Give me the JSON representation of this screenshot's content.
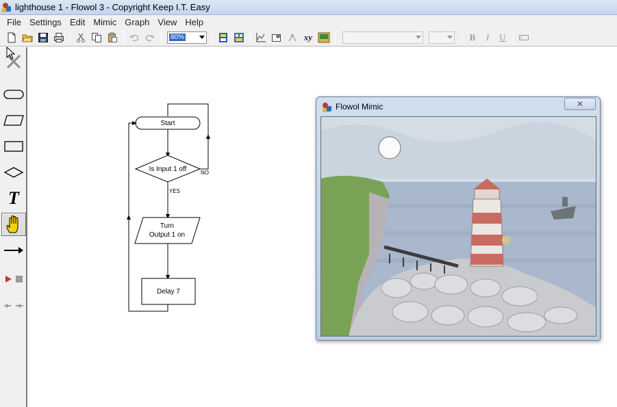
{
  "window": {
    "title": "lighthouse 1 - Flowol 3 - Copyright Keep I.T. Easy"
  },
  "menu": [
    "File",
    "Settings",
    "Edit",
    "Mimic",
    "Graph",
    "View",
    "Help"
  ],
  "toolbar": {
    "zoom_value": "80%",
    "font_value": "",
    "size_value": "",
    "bold_label": "B",
    "italic_label": "I",
    "underline_label": "U",
    "xy_label": "xy"
  },
  "palette": {
    "text_tool_label": "T",
    "active_tool": "hand-tool"
  },
  "flowchart": {
    "start_label": "Start",
    "decision_label": "Is Input 1 off",
    "no_label": "NO",
    "yes_label": "YES",
    "output_line1": "Turn",
    "output_line2": "Output 1 on",
    "delay_label": "Delay 7"
  },
  "mimic": {
    "title": "Flowol Mimic",
    "close_symbol": "✕"
  },
  "colors": {
    "accent": "#3168c6",
    "run_red": "#c0392b",
    "hand_yellow": "#f4d20d"
  }
}
